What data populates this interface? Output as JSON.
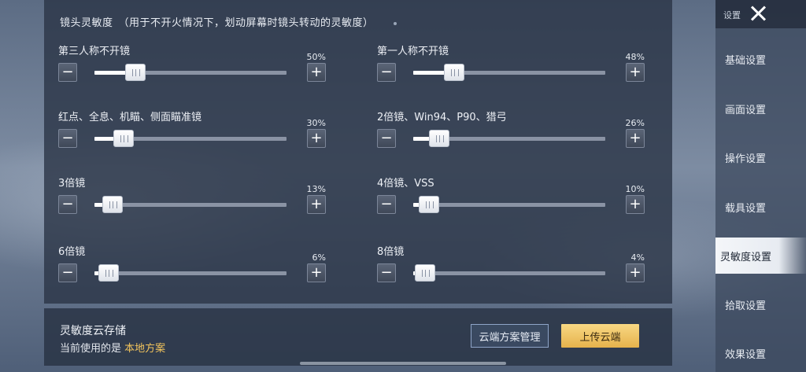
{
  "panel": {
    "section_title": "镜头灵敏度　（用于不开火情况下，划动屏幕时镜头转动的灵敏度）",
    "sliders": [
      {
        "label": "第三人称不开镜",
        "percent_label": "50%",
        "value": 0.16
      },
      {
        "label": "第一人称不开镜",
        "percent_label": "48%",
        "value": 0.16
      },
      {
        "label": "红点、全息、机瞄、侧面瞄准镜",
        "percent_label": "30%",
        "value": 0.1
      },
      {
        "label": "2倍镜、Win94、P90、猎弓",
        "percent_label": "26%",
        "value": 0.08
      },
      {
        "label": "3倍镜",
        "percent_label": "13%",
        "value": 0.04
      },
      {
        "label": "4倍镜、VSS",
        "percent_label": "10%",
        "value": 0.03
      },
      {
        "label": "6倍镜",
        "percent_label": "6%",
        "value": 0.02
      },
      {
        "label": "8倍镜",
        "percent_label": "4%",
        "value": 0.01
      }
    ],
    "minus_symbol": "−",
    "plus_symbol": "+"
  },
  "footer": {
    "cloud_title": "灵敏度云存储",
    "current_prefix": "当前使用的是",
    "current_plan": "本地方案",
    "manage_button": "云端方案管理",
    "upload_button": "上传云端"
  },
  "sidebar": {
    "header_label": "设置",
    "items": [
      {
        "label": "基础设置",
        "active": false
      },
      {
        "label": "画面设置",
        "active": false
      },
      {
        "label": "操作设置",
        "active": false
      },
      {
        "label": "载具设置",
        "active": false
      },
      {
        "label": "灵敏度设置",
        "active": true
      },
      {
        "label": "拾取设置",
        "active": false
      },
      {
        "label": "效果设置",
        "active": false
      }
    ]
  },
  "colors": {
    "accent_gold": "#f1c35c",
    "upload_button": "#e6b24c",
    "panel_bg": "#2a3446"
  }
}
